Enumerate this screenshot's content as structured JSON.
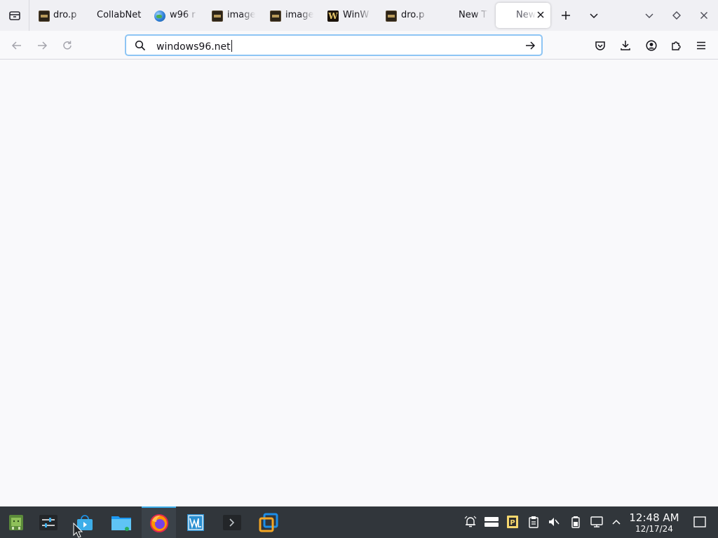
{
  "browser": {
    "tabs": [
      {
        "label": "dro.p",
        "favicon": "dark-thumbnail-icon",
        "active": false
      },
      {
        "label": "CollabNet",
        "favicon": "",
        "active": false
      },
      {
        "label": "w96 r",
        "favicon": "globe-icon",
        "active": false
      },
      {
        "label": "image",
        "favicon": "dark-thumbnail-icon",
        "active": false
      },
      {
        "label": "image",
        "favicon": "dark-thumbnail-icon",
        "active": false
      },
      {
        "label": "WinW",
        "favicon": "w-logo-icon",
        "active": false
      },
      {
        "label": "dro.p",
        "favicon": "dark-thumbnail-icon",
        "active": false
      },
      {
        "label": "New T",
        "favicon": "",
        "active": false
      },
      {
        "label": "New",
        "favicon": "",
        "active": true
      }
    ],
    "w_logo_letter": "W",
    "url_value": "windows96.net"
  },
  "taskbar": {
    "clock_time": "12:48 AM",
    "clock_date": "12/17/24"
  },
  "colors": {
    "accent": "#3daee9",
    "urlbar_focus": "#8ec5f4",
    "taskbar_bg": "#31363b",
    "tabstrip_bg": "#f0f0f4"
  }
}
